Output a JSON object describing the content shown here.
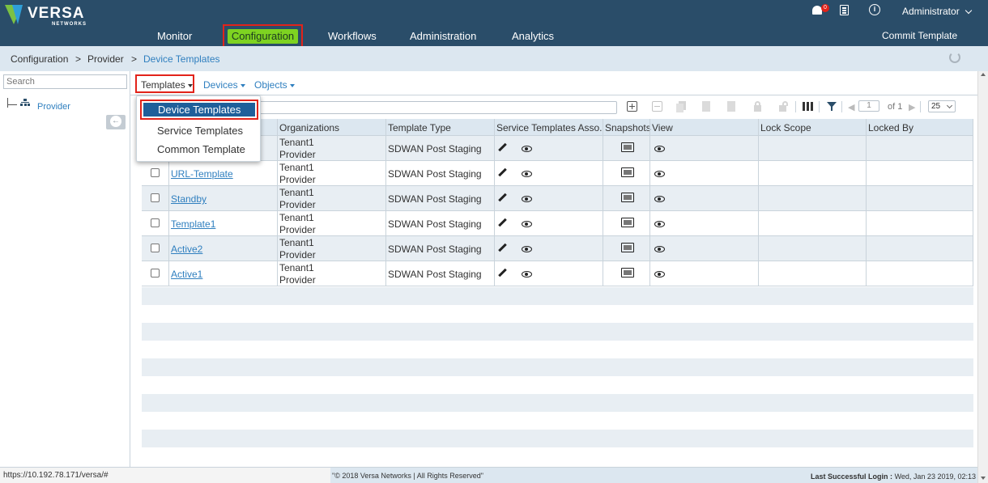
{
  "header": {
    "logo_text": "VERSA",
    "logo_sub": "NETWORKS",
    "nav": [
      "Monitor",
      "Configuration",
      "Workflows",
      "Administration",
      "Analytics"
    ],
    "active_nav": "Configuration",
    "notification_count": "0",
    "user": "Administrator",
    "commit_label": "Commit Template"
  },
  "breadcrumb": {
    "items": [
      "Configuration",
      "Provider",
      "Device Templates"
    ],
    "separator": ">"
  },
  "sidebar": {
    "search_placeholder": "Search",
    "tree_root": "Provider"
  },
  "subtabs": {
    "templates": "Templates",
    "devices": "Devices",
    "objects": "Objects"
  },
  "dropdown": {
    "items": [
      "Device Templates",
      "Service Templates",
      "Common Template"
    ],
    "selected": "Device Templates"
  },
  "pager": {
    "page": "1",
    "of_label": "of",
    "total": "1",
    "page_size": "25"
  },
  "table": {
    "columns": [
      "Organizations",
      "Template Type",
      "Service Templates Asso...",
      "Snapshots",
      "View",
      "Lock Scope",
      "Locked By"
    ],
    "rows": [
      {
        "name": "",
        "org1": "Tenant1",
        "org2": "Provider",
        "type": "SDWAN Post Staging"
      },
      {
        "name": "URL-Template",
        "org1": "Tenant1",
        "org2": "Provider",
        "type": "SDWAN Post Staging"
      },
      {
        "name": "Standby",
        "org1": "Tenant1",
        "org2": "Provider",
        "type": "SDWAN Post Staging"
      },
      {
        "name": "Template1",
        "org1": "Tenant1",
        "org2": "Provider",
        "type": "SDWAN Post Staging"
      },
      {
        "name": "Active2",
        "org1": "Tenant1",
        "org2": "Provider",
        "type": "SDWAN Post Staging"
      },
      {
        "name": "Active1",
        "org1": "Tenant1",
        "org2": "Provider",
        "type": "SDWAN Post Staging"
      }
    ]
  },
  "footer": {
    "copyright": "\"© 2018 Versa Networks | All Rights Reserved\"",
    "last_login_label": "Last Successful Login :",
    "last_login_value": "Wed, Jan 23 2019, 02:13"
  },
  "status_url": "https://10.192.78.171/versa/#",
  "colors": {
    "header_bg": "#2a4d69",
    "active_nav_bg": "#7ed321",
    "highlight_border": "#e2231a",
    "dropdown_active_bg": "#1f5f9a",
    "link": "#2f7fbf"
  }
}
